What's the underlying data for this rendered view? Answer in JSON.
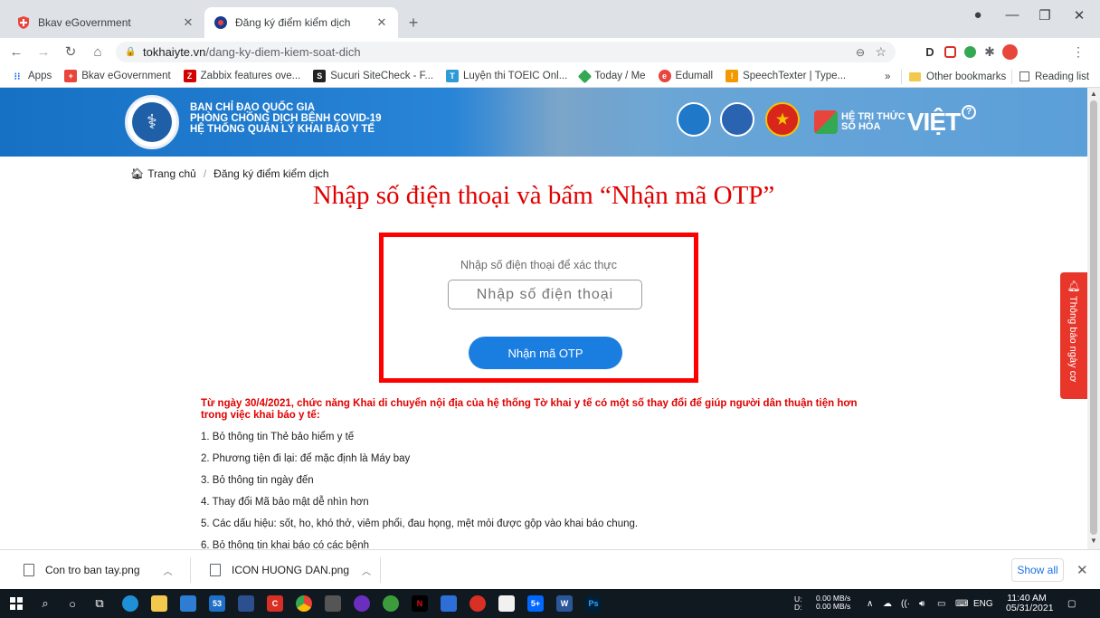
{
  "browser": {
    "tabs": [
      {
        "title": "Bkav eGovernment",
        "active": false,
        "favicon_color": "#e8453c"
      },
      {
        "title": "Đăng ký điểm kiểm dịch",
        "active": true,
        "favicon_color": "#1a3a8f"
      }
    ],
    "url_host": "tokhaiyte.vn",
    "url_path": "/dang-ky-diem-kiem-soat-dich",
    "bookmarks": [
      {
        "label": "Apps",
        "icon": "apps-grid-icon",
        "color": "#1a73e8"
      },
      {
        "label": "Bkav eGovernment",
        "icon": "bkav-icon",
        "color": "#e8453c"
      },
      {
        "label": "Zabbix features ove...",
        "icon": "zabbix-icon",
        "color": "#d40000"
      },
      {
        "label": "Sucuri SiteCheck - F...",
        "icon": "sucuri-icon",
        "color": "#222222"
      },
      {
        "label": "Luyện thi TOEIC Onl...",
        "icon": "toeic-icon",
        "color": "#2e9bd6"
      },
      {
        "label": "Today / Me",
        "icon": "today-icon",
        "color": "#34a853"
      },
      {
        "label": "Edumall",
        "icon": "edumall-icon",
        "color": "#e8453c"
      },
      {
        "label": "SpeechTexter | Type...",
        "icon": "speechtexter-icon",
        "color": "#f29900"
      }
    ],
    "other_bookmarks": "Other bookmarks",
    "reading_list": "Reading list",
    "overflow": "»"
  },
  "site": {
    "banner_lines": [
      "BAN CHỈ ĐẠO QUỐC GIA",
      "PHÒNG CHỐNG DỊCH BỆNH COVID-19",
      "HỆ THỐNG QUẢN LÝ KHAI BÁO Y TẾ"
    ],
    "brand_small": [
      "HỆ TRI THỨC",
      "SỐ HÓA"
    ],
    "brand_big": "VIỆT",
    "breadcrumb": {
      "home": "Trang chủ",
      "current": "Đăng ký điểm kiểm dịch"
    },
    "instruction": "Nhập số điện thoại và bấm “Nhận mã OTP”",
    "otp": {
      "label": "Nhập số điện thoại để xác thực",
      "placeholder": "Nhập số điện thoại",
      "button": "Nhận mã OTP"
    },
    "notice": "Từ ngày 30/4/2021, chức năng Khai di chuyển nội địa của hệ thống Tờ khai y tế có một số thay đổi để giúp người dân thuận tiện hơn trong việc khai báo y tế:",
    "changes": [
      "1. Bỏ thông tin Thẻ bảo hiểm y tế",
      "2. Phương tiện đi lại: để mặc định là Máy bay",
      "3. Bỏ thông tin ngày đến",
      "4. Thay đổi Mã bảo mật dễ nhìn hơn",
      "5. Các dấu hiệu: sốt, ho, khó thở, viêm phổi, đau họng, mệt mỏi được gộp vào khai báo chung.",
      "6. Bỏ thông tin khai báo có các bệnh"
    ],
    "side_tab": "Thông báo ngày cơ"
  },
  "downloads": {
    "items": [
      "Con tro ban tay.png",
      "ICON HUONG DAN.png"
    ],
    "show_all": "Show all"
  },
  "taskbar": {
    "net_up": "0.00 MB/s",
    "net_down": "0.00 MB/s",
    "net_u": "U:",
    "net_d": "D:",
    "lang": "ENG",
    "time": "11:40 AM",
    "date": "05/31/2021",
    "badge_mail": "53",
    "badge_zalo": "5+"
  },
  "colors": {
    "accent_red": "#e10000",
    "otp_button": "#1a7ee0",
    "banner_blue": "#1670c4"
  }
}
